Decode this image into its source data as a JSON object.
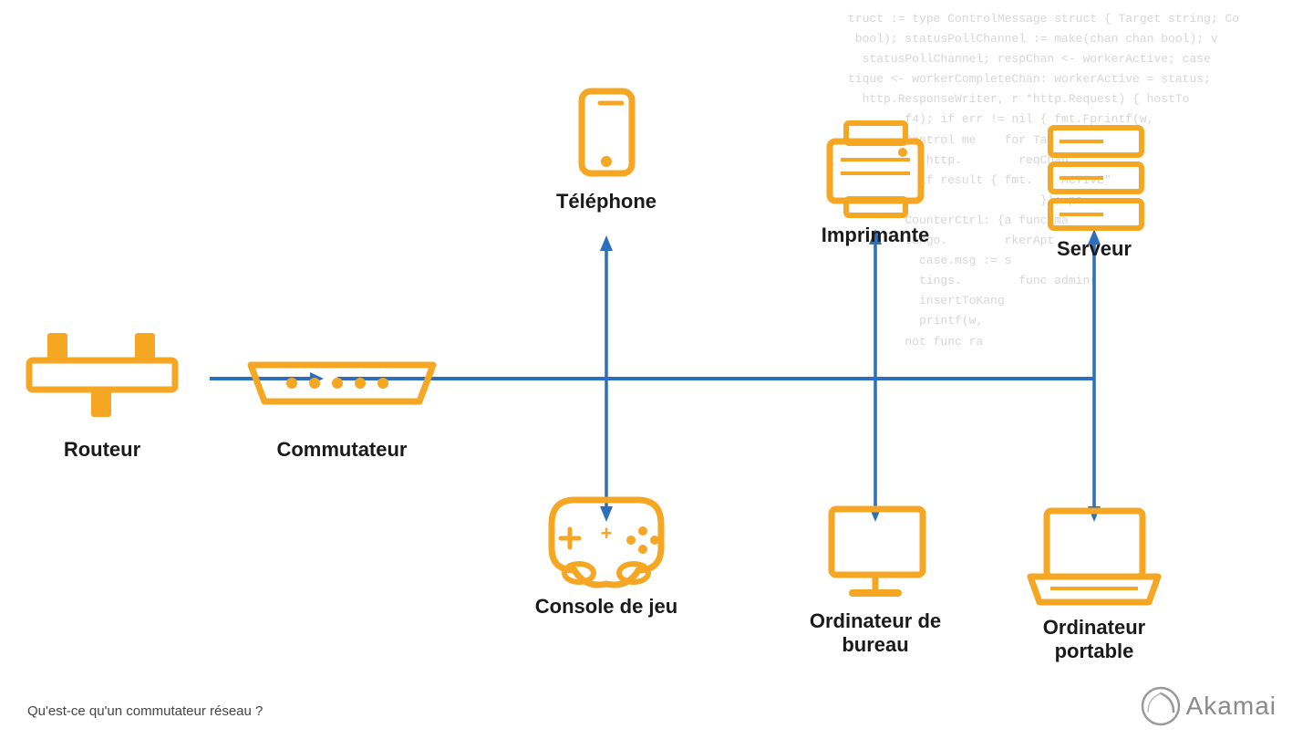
{
  "bg_code": "truct := type ControlMessage struct { Target string; Co\n bool); statusPollChannel := make(chan chan bool); v\n  statusPollChannel; respChan <- workerActive; case\ntique <- workerCompleteChan: workerActive = status;\n  http.ResponseWriter, r *http.Request) { hostTo\n        f4); if err != nil { fmt.Fprintf(w,\n        Control me    for Ta\n          *http.        reqChan\n          if result { fmt.    ACTIVE\"\n                           }); pa\n        CounterCtrl: {a func ma\n        tango.        rkerApt\n          case.msg := s\n          tings.        func admin(\n          insertToKang\n          printf(w,\n        not func ra",
  "devices": {
    "router": {
      "label": "Routeur"
    },
    "commutateur": {
      "label": "Commutateur"
    },
    "telephone": {
      "label": "Téléphone"
    },
    "imprimante": {
      "label": "Imprimante"
    },
    "serveur": {
      "label": "Serveur"
    },
    "console": {
      "label": "Console de jeu"
    },
    "ordinateur_bureau": {
      "label": "Ordinateur de\nbureau"
    },
    "ordinateur_portable": {
      "label": "Ordinateur\nportable"
    }
  },
  "bottom_text": "Qu'est-ce qu'un commutateur réseau ?",
  "akamai_label": "Akamai",
  "accent_color": "#f5a623",
  "line_color": "#2e6fbd"
}
